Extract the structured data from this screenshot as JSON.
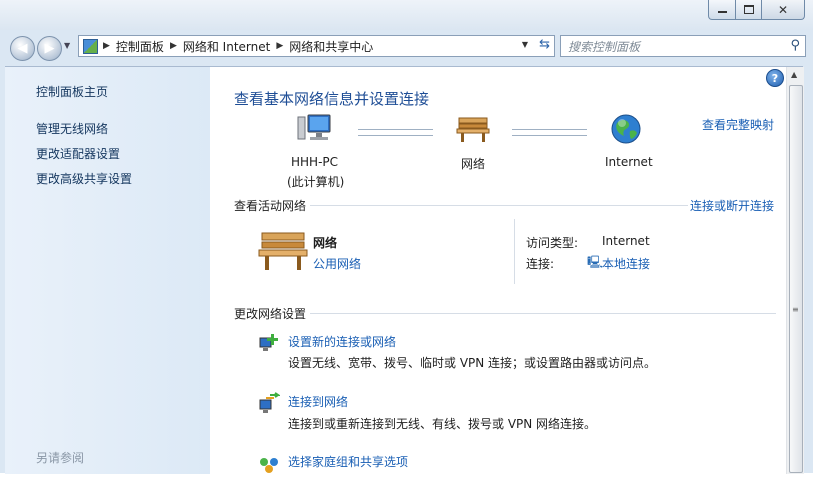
{
  "window": {
    "controls": {
      "minimize_icon": "minimize-icon",
      "maximize_icon": "maximize-icon",
      "close_icon": "close-icon"
    }
  },
  "address_bar": {
    "breadcrumbs": [
      "控制面板",
      "网络和 Internet",
      "网络和共享中心"
    ]
  },
  "search": {
    "placeholder": "搜索控制面板"
  },
  "sidebar": {
    "home": "控制面板主页",
    "items": [
      "管理无线网络",
      "更改适配器设置",
      "更改高级共享设置"
    ],
    "see_also": "另请参阅"
  },
  "main": {
    "title": "查看基本网络信息并设置连接",
    "view_full_map": "查看完整映射",
    "map": {
      "computer_name": "HHH-PC",
      "computer_sub": "(此计算机)",
      "network_label": "网络",
      "internet_label": "Internet"
    },
    "active_networks": {
      "heading": "查看活动网络",
      "connect_link": "连接或断开连接",
      "network_name": "网络",
      "network_type": "公用网络",
      "access_type_label": "访问类型:",
      "access_type_value": "Internet",
      "connections_label": "连接:",
      "connections_value": "本地连接"
    },
    "change_settings": {
      "heading": "更改网络设置",
      "tasks": [
        {
          "title": "设置新的连接或网络",
          "desc": "设置无线、宽带、拨号、临时或 VPN 连接；或设置路由器或访问点。"
        },
        {
          "title": "连接到网络",
          "desc": "连接到或重新连接到无线、有线、拨号或 VPN 网络连接。"
        },
        {
          "title": "选择家庭组和共享选项",
          "desc": ""
        }
      ]
    }
  },
  "colors": {
    "link": "#1a5fb4",
    "heading": "#1f4e96",
    "sidebar_bg": "#dce9f6"
  }
}
